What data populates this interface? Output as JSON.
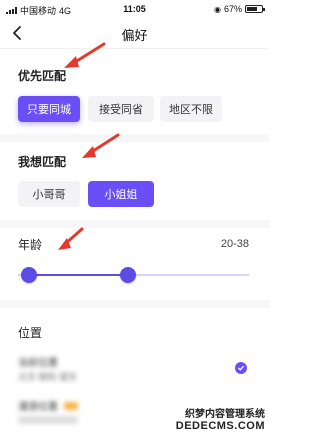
{
  "status_bar": {
    "carrier": "中国移动",
    "network": "4G",
    "time": "11:05",
    "battery": "67%"
  },
  "nav": {
    "title": "偏好"
  },
  "priority": {
    "title": "优先匹配",
    "options": [
      "只要同城",
      "接受同省",
      "地区不限"
    ],
    "selected": "只要同城"
  },
  "want_match": {
    "title": "我想匹配",
    "options": [
      "小哥哥",
      "小姐姐"
    ],
    "selected": "小姐姐"
  },
  "age": {
    "title": "年龄",
    "range_text": "20-38",
    "min": 20,
    "max": 38
  },
  "location": {
    "title": "位置",
    "current_label": "当前位置",
    "current_value": "北京 朝阳 望京",
    "second_label": "漫游位置",
    "second_value": ""
  },
  "watermark": {
    "line1": "织梦内容管理系统",
    "line2": "DEDECMS.COM"
  },
  "colors": {
    "accent": "#6a4ff6",
    "arrow": "#e23b2e"
  }
}
